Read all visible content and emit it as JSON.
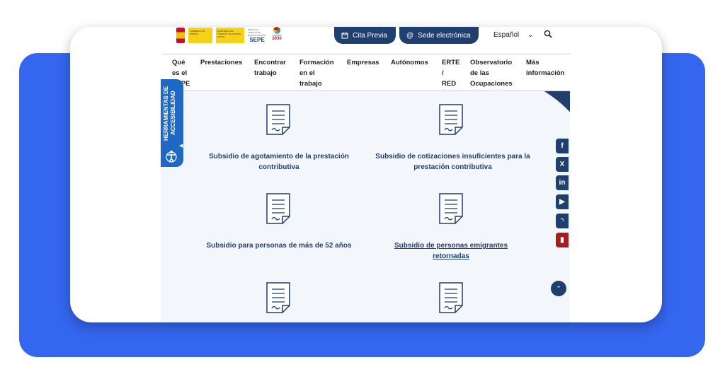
{
  "header": {
    "logos": {
      "gobierno_text": "GOBIERNO DE ESPAÑA",
      "ministerio_text": "MINISTERIO DE TRABAJO Y ECONOMÍA SOCIAL",
      "sepe_small": "SERVICIO PÚBLICO DE EMPLEO ESTATAL",
      "sepe_word": "SEPE",
      "agenda_text": "AGENDA",
      "agenda_year": "2030"
    },
    "cita_previa": "Cita Previa",
    "sede_electronica": "Sede electrónica",
    "language": "Español",
    "language_caret": "⌄",
    "search_icon": "search-icon"
  },
  "nav": [
    {
      "lines": [
        "Qué",
        "es el",
        "SEPE"
      ]
    },
    {
      "lines": [
        "Prestaciones"
      ]
    },
    {
      "lines": [
        "Encontrar",
        "trabajo"
      ]
    },
    {
      "lines": [
        "Formación",
        "en el",
        "trabajo"
      ]
    },
    {
      "lines": [
        "Empresas"
      ]
    },
    {
      "lines": [
        "Autónomos"
      ]
    },
    {
      "lines": [
        "ERTE",
        "/",
        "RED"
      ]
    },
    {
      "lines": [
        "Observatorio",
        "de las",
        "Ocupaciones"
      ]
    },
    {
      "lines": [
        "Más",
        "información"
      ]
    }
  ],
  "accessibility": {
    "label": "HERRAMIENTAS DE ACCESIBILIDAD",
    "caret": "◀"
  },
  "documents": [
    {
      "title": "Subsidio de agotamiento de la prestación contributiva",
      "linked": false
    },
    {
      "title": "Subsidio de cotizaciones insuficientes para la prestación contributiva",
      "linked": false
    },
    {
      "title": "Subsidio para personas de más de 52 años",
      "linked": false
    },
    {
      "title": "Subsidio de personas emigrantes retornadas",
      "linked": true
    },
    {
      "title": "",
      "linked": false
    },
    {
      "title": "",
      "linked": false
    }
  ],
  "social": [
    {
      "name": "facebook-icon",
      "glyph": "f"
    },
    {
      "name": "x-icon",
      "glyph": "X"
    },
    {
      "name": "linkedin-icon",
      "glyph": "in"
    },
    {
      "name": "youtube-icon",
      "glyph": "▶"
    },
    {
      "name": "rss-icon",
      "glyph": "◝"
    },
    {
      "name": "pdf-icon",
      "glyph": "▮"
    }
  ],
  "scroll_top": "⌃",
  "colors": {
    "accent_blue": "#3566f0",
    "navy": "#1f3f6e",
    "a11y_blue": "#1f69c5",
    "pdf_red": "#a3201f"
  }
}
